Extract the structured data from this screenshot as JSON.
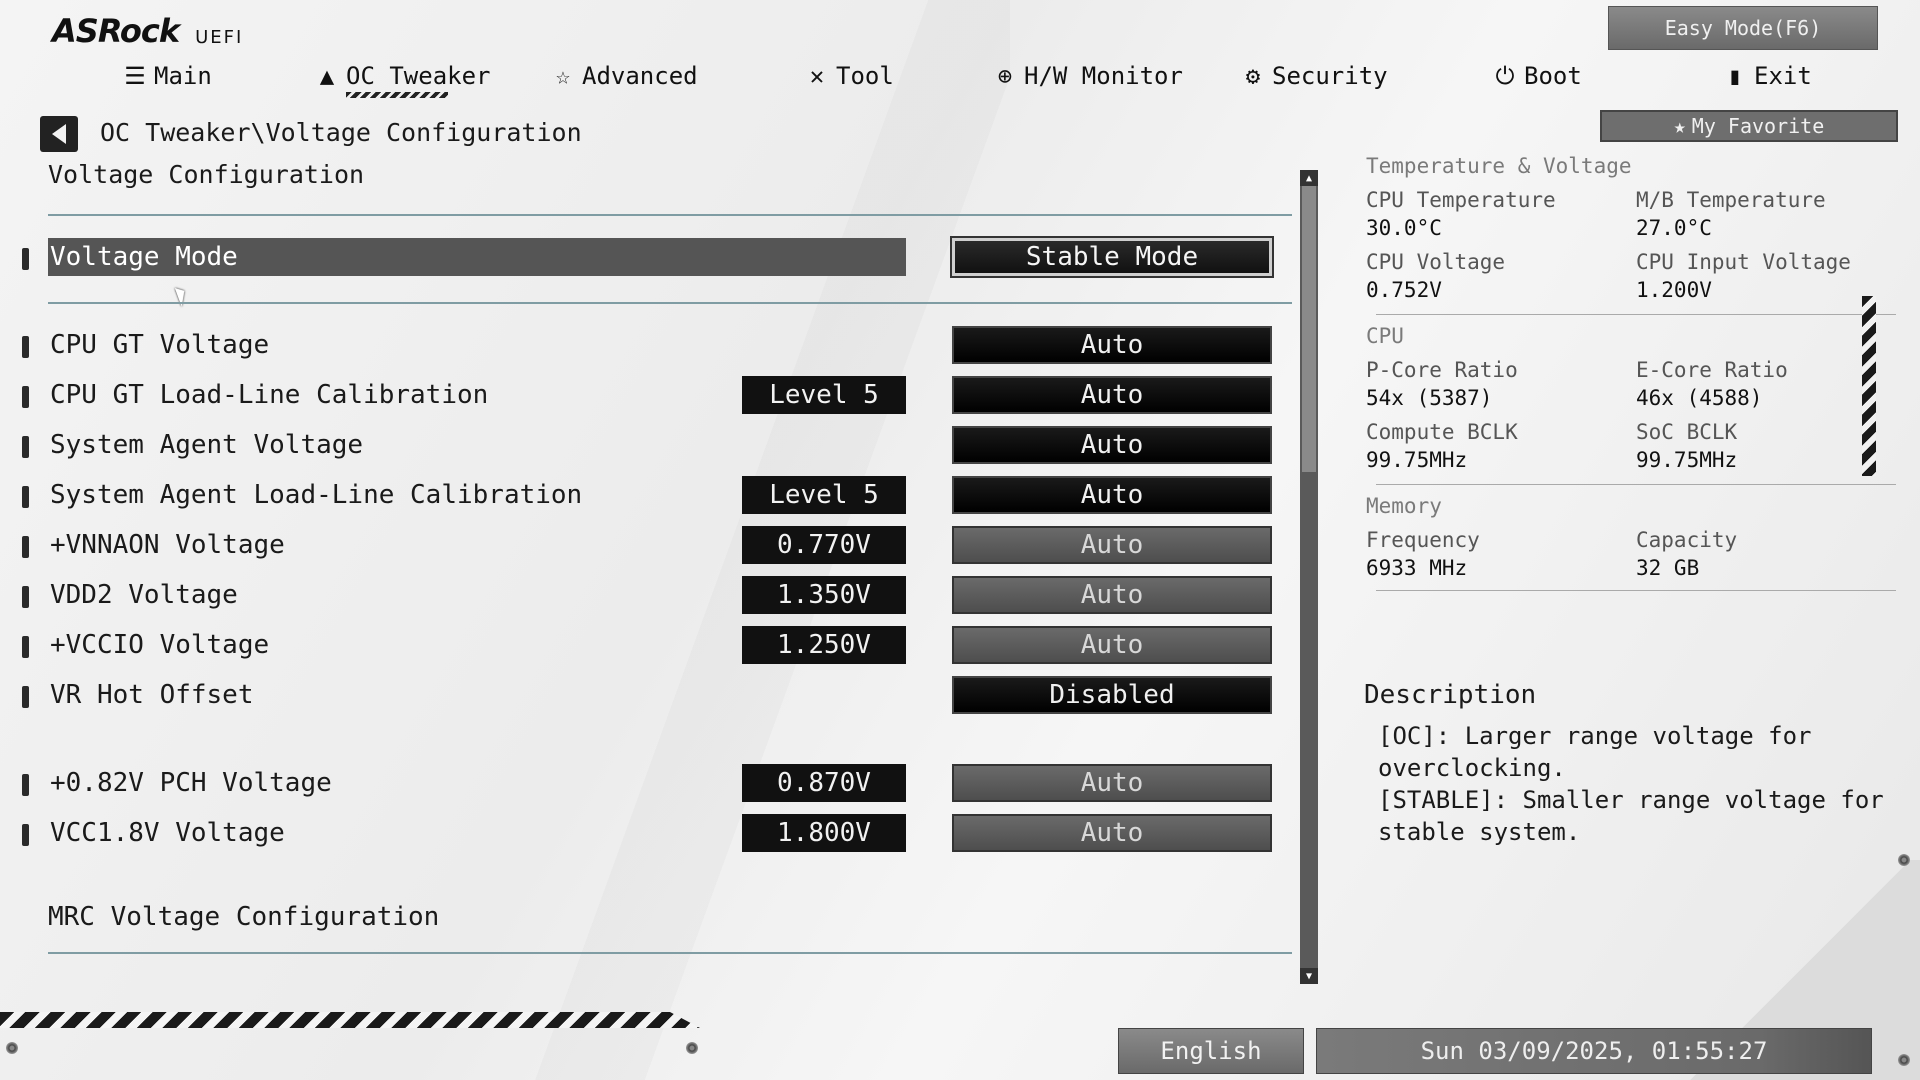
{
  "brand": {
    "logo": "ASRock",
    "sub": "UEFI"
  },
  "header": {
    "easy_mode": "Easy Mode(F6)",
    "my_favorite": "My Favorite",
    "tabs": [
      {
        "label": "Main",
        "icon": "list-icon"
      },
      {
        "label": "OC Tweaker",
        "icon": "rocket-icon",
        "active": true
      },
      {
        "label": "Advanced",
        "icon": "star-icon"
      },
      {
        "label": "Tool",
        "icon": "wrench-icon"
      },
      {
        "label": "H/W Monitor",
        "icon": "crosshair-icon"
      },
      {
        "label": "Security",
        "icon": "shield-icon"
      },
      {
        "label": "Boot",
        "icon": "power-icon"
      },
      {
        "label": "Exit",
        "icon": "door-icon"
      }
    ]
  },
  "breadcrumb": "OC Tweaker\\Voltage Configuration",
  "section_title": "Voltage Configuration",
  "settings": [
    {
      "label": "Voltage Mode",
      "current": "",
      "value": "Stable Mode",
      "style": "stable",
      "selected": true
    },
    {
      "label": "CPU GT Voltage",
      "current": "",
      "value": "Auto",
      "style": "dark"
    },
    {
      "label": "CPU GT Load-Line Calibration",
      "current": "Level 5",
      "value": "Auto",
      "style": "dark"
    },
    {
      "label": "System Agent Voltage",
      "current": "",
      "value": "Auto",
      "style": "dark"
    },
    {
      "label": "System Agent Load-Line Calibration",
      "current": "Level 5",
      "value": "Auto",
      "style": "dark"
    },
    {
      "label": "+VNNAON Voltage",
      "current": "0.770V",
      "value": "Auto",
      "style": "grey"
    },
    {
      "label": "VDD2 Voltage",
      "current": "1.350V",
      "value": "Auto",
      "style": "grey"
    },
    {
      "label": "+VCCIO Voltage",
      "current": "1.250V",
      "value": "Auto",
      "style": "grey"
    },
    {
      "label": "VR Hot Offset",
      "current": "",
      "value": "Disabled",
      "style": "dark"
    },
    {
      "label": "+0.82V PCH Voltage",
      "current": "0.870V",
      "value": "Auto",
      "style": "grey"
    },
    {
      "label": "VCC1.8V Voltage",
      "current": "1.800V",
      "value": "Auto",
      "style": "grey"
    }
  ],
  "submenu": "MRC Voltage Configuration",
  "monitor": {
    "temp_voltage": {
      "heading": "Temperature & Voltage",
      "cpu_temp_label": "CPU Temperature",
      "cpu_temp": "30.0°C",
      "mb_temp_label": "M/B Temperature",
      "mb_temp": "27.0°C",
      "cpu_volt_label": "CPU Voltage",
      "cpu_volt": "0.752V",
      "cpu_in_label": "CPU Input Voltage",
      "cpu_in": "1.200V"
    },
    "cpu": {
      "heading": "CPU",
      "pcore_label": "P-Core Ratio",
      "pcore": "54x (5387)",
      "ecore_label": "E-Core Ratio",
      "ecore": "46x (4588)",
      "bclk_label": "Compute BCLK",
      "bclk": "99.75MHz",
      "soc_label": "SoC BCLK",
      "soc": "99.75MHz"
    },
    "memory": {
      "heading": "Memory",
      "freq_label": "Frequency",
      "freq": "6933 MHz",
      "cap_label": "Capacity",
      "cap": "32 GB"
    }
  },
  "description": {
    "title": "Description",
    "lines": [
      "[OC]: Larger range voltage for",
      "overclocking.",
      "[STABLE]: Smaller range voltage for",
      "stable system."
    ]
  },
  "footer": {
    "language": "English",
    "datetime": "Sun 03/09/2025, 01:55:27"
  }
}
